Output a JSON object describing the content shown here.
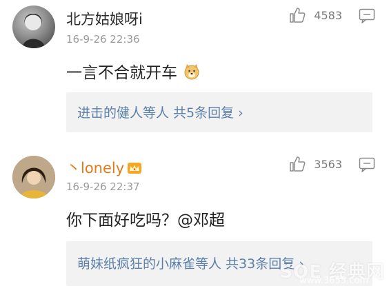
{
  "comments": [
    {
      "username": "北方姑娘呀i",
      "timestamp": "16-9-26 22:36",
      "likes": "4583",
      "content": "一言不合就开车",
      "content_emoji": "dog-emoji",
      "replies_summary": "进击的健人等人  共5条回复",
      "replies_chevron": "›"
    },
    {
      "username": "丶lonely",
      "username_badge": "vip-crown-icon",
      "timestamp": "16-9-26 22:37",
      "likes": "3563",
      "content": "你下面好吃吗？@邓超",
      "replies_summary": "萌妹纸疯狂的小麻雀等人  共33条回复",
      "replies_chevron": "›"
    }
  ],
  "watermark": {
    "text": "SOE 经典网",
    "sub": "www.3655.com"
  },
  "colors": {
    "link_blue": "#5a7fa8",
    "reply_bg": "#f2f2f2",
    "vip_name": "#e07a1a"
  }
}
